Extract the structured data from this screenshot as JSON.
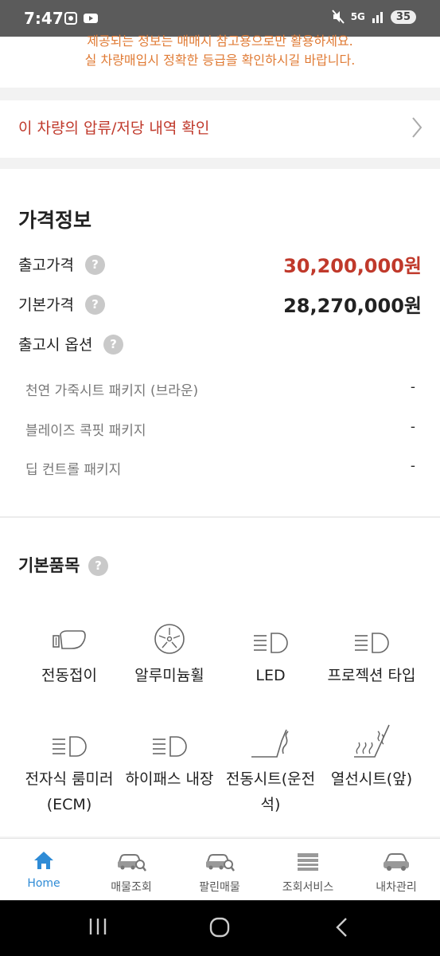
{
  "status_bar": {
    "time": "7:47",
    "network": "5G",
    "battery": "35"
  },
  "notice": {
    "line1": "제공되는 정보는 매매시 참고용으로만 활용하세요.",
    "line2": "실 차량매입시 정확한 등급을 확인하시길 바랍니다."
  },
  "lien": {
    "label": "이 차량의 압류/저당 내역 확인"
  },
  "price_info": {
    "title": "가격정보",
    "release_price_label": "출고가격",
    "release_price_value": "30,200,000원",
    "base_price_label": "기본가격",
    "base_price_value": "28,270,000원",
    "options_label": "출고시 옵션",
    "options": [
      {
        "name": "천연 가죽시트 패키지 (브라운)",
        "price": "-"
      },
      {
        "name": "블레이즈 콕핏 패키지",
        "price": "-"
      },
      {
        "name": "딥 컨트롤 패키지",
        "price": "-"
      }
    ],
    "help_glyph": "?"
  },
  "basic_items": {
    "title": "기본품목",
    "features": [
      {
        "label": "전동접이",
        "icon": "side-mirror-icon"
      },
      {
        "label": "알루미늄휠",
        "icon": "alloy-wheel-icon"
      },
      {
        "label": "LED",
        "icon": "headlight-icon"
      },
      {
        "label": "프로젝션 타입",
        "icon": "headlight-icon"
      },
      {
        "label": "전자식 룸미러\n(ECM)",
        "icon": "headlight-icon"
      },
      {
        "label": "하이패스 내장",
        "icon": "headlight-icon"
      },
      {
        "label": "전동시트(운전\n석)",
        "icon": "power-seat-icon"
      },
      {
        "label": "열선시트(앞)",
        "icon": "heated-seat-icon"
      }
    ]
  },
  "tabs": [
    {
      "label": "Home",
      "icon": "home-icon",
      "active": true
    },
    {
      "label": "매물조회",
      "icon": "car-search-icon",
      "active": false
    },
    {
      "label": "팔린매물",
      "icon": "car-search-icon",
      "active": false
    },
    {
      "label": "조회서비스",
      "icon": "list-icon",
      "active": false
    },
    {
      "label": "내차관리",
      "icon": "car-icon",
      "active": false
    }
  ],
  "colors": {
    "accent_red": "#c0392b",
    "notice_orange": "#e07b35",
    "active_tab": "#2e8bd6"
  }
}
